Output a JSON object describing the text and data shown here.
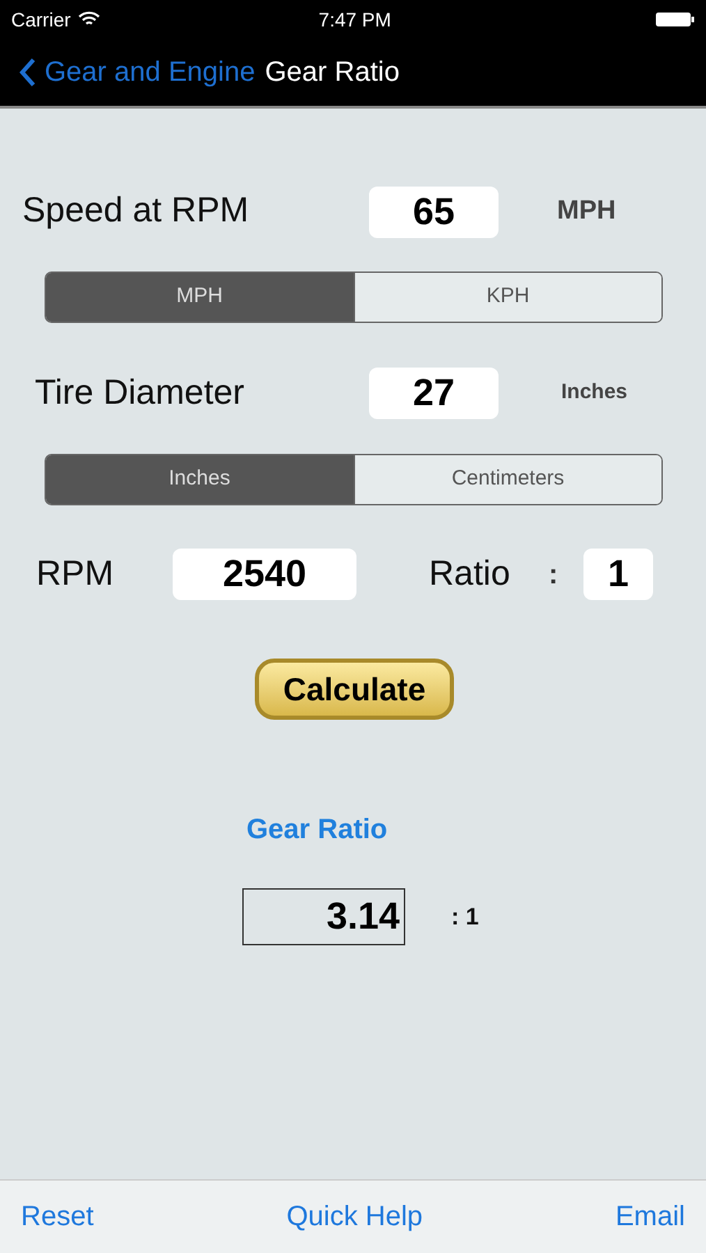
{
  "status_bar": {
    "carrier": "Carrier",
    "time": "7:47 PM"
  },
  "nav": {
    "back": "Gear and Engine",
    "title": "Gear Ratio"
  },
  "speed": {
    "label": "Speed at RPM",
    "value": "65",
    "unit": "MPH"
  },
  "speed_units": [
    {
      "label": "MPH",
      "selected": true
    },
    {
      "label": "KPH",
      "selected": false
    }
  ],
  "tire": {
    "label": "Tire Diameter",
    "value": "27",
    "unit": "Inches"
  },
  "tire_units": [
    {
      "label": "Inches",
      "selected": true
    },
    {
      "label": "Centimeters",
      "selected": false
    }
  ],
  "rpm": {
    "label": "RPM",
    "value": "2540"
  },
  "ratio": {
    "label": "Ratio",
    "separator": ":",
    "value": "1"
  },
  "calculate_button": "Calculate",
  "result": {
    "heading": "Gear Ratio",
    "value": "3.14",
    "suffix": ": 1"
  },
  "toolbar": [
    "Reset",
    "Quick Help",
    "Email"
  ]
}
